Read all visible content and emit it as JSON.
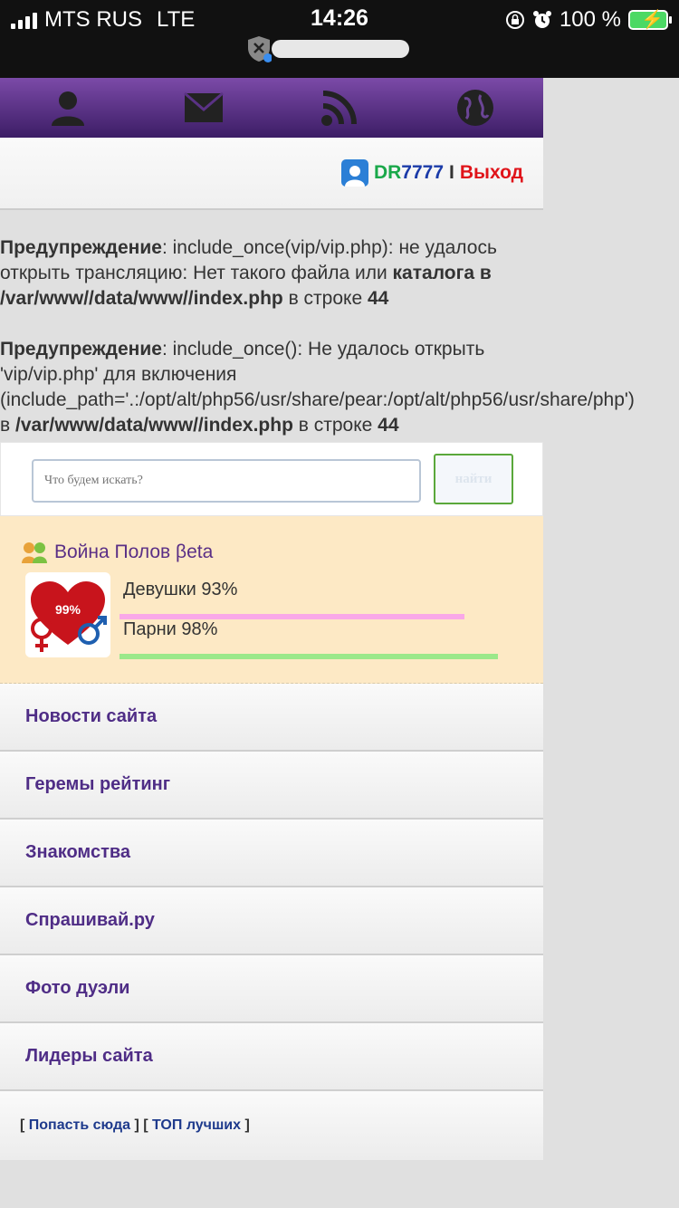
{
  "status_bar": {
    "carrier": "MTS RUS",
    "network": "LTE",
    "time": "14:26",
    "battery": "100 %"
  },
  "top_nav": {
    "icons": [
      "user-icon",
      "mail-icon",
      "rss-icon",
      "globe-icon"
    ]
  },
  "user_bar": {
    "username_part1": "DR",
    "username_part2": "7777",
    "separator": "I",
    "logout_label": "Выход"
  },
  "warnings": [
    {
      "label": "Предупреждение",
      "text1": ": include_once(vip/vip.php): не удалось открыть трансляцию: Нет такого файла или ",
      "bold1": "каталога в /var/www/",
      "mid": "",
      "bold2": "/data/www/",
      "bold3": "/index.php",
      "text2": " в строке ",
      "line": "44"
    },
    {
      "label": "Предупреждение",
      "text1": ": include_once(): Не удалось открыть 'vip/vip.php' для включения (include_path='.:/opt/alt/php56/usr/share/pear:/opt/alt/php56/usr/share/php') в ",
      "bold1": "/var/www/",
      "mid": "",
      "bold2": "data/www/",
      "bold3": "/index.php",
      "text2": " в строке ",
      "line": "44"
    }
  ],
  "search": {
    "placeholder": "Что будем искать?",
    "button_label": "найти"
  },
  "war": {
    "title": "Война Полов βeta",
    "badge_percent": "99%",
    "girls_label": "Девушки 93%",
    "girls_value": 93,
    "girls_color": "#f9a8e8",
    "boys_label": "Парни 98%",
    "boys_value": 98,
    "boys_color": "#9be88a"
  },
  "menu": [
    "Новости сайта",
    "Геремы рейтинг",
    "Знакомства",
    "Спрашивай.ру",
    "Фото дуэли",
    "Лидеры сайта"
  ],
  "footer": {
    "link1": "Попасть сюда",
    "link2": "ТОП лучших"
  },
  "colors": {
    "nav_gradient_top": "#7b4aa8",
    "nav_gradient_bottom": "#3c1d66",
    "menu_text": "#4f2d86",
    "logout": "#e0141a"
  }
}
